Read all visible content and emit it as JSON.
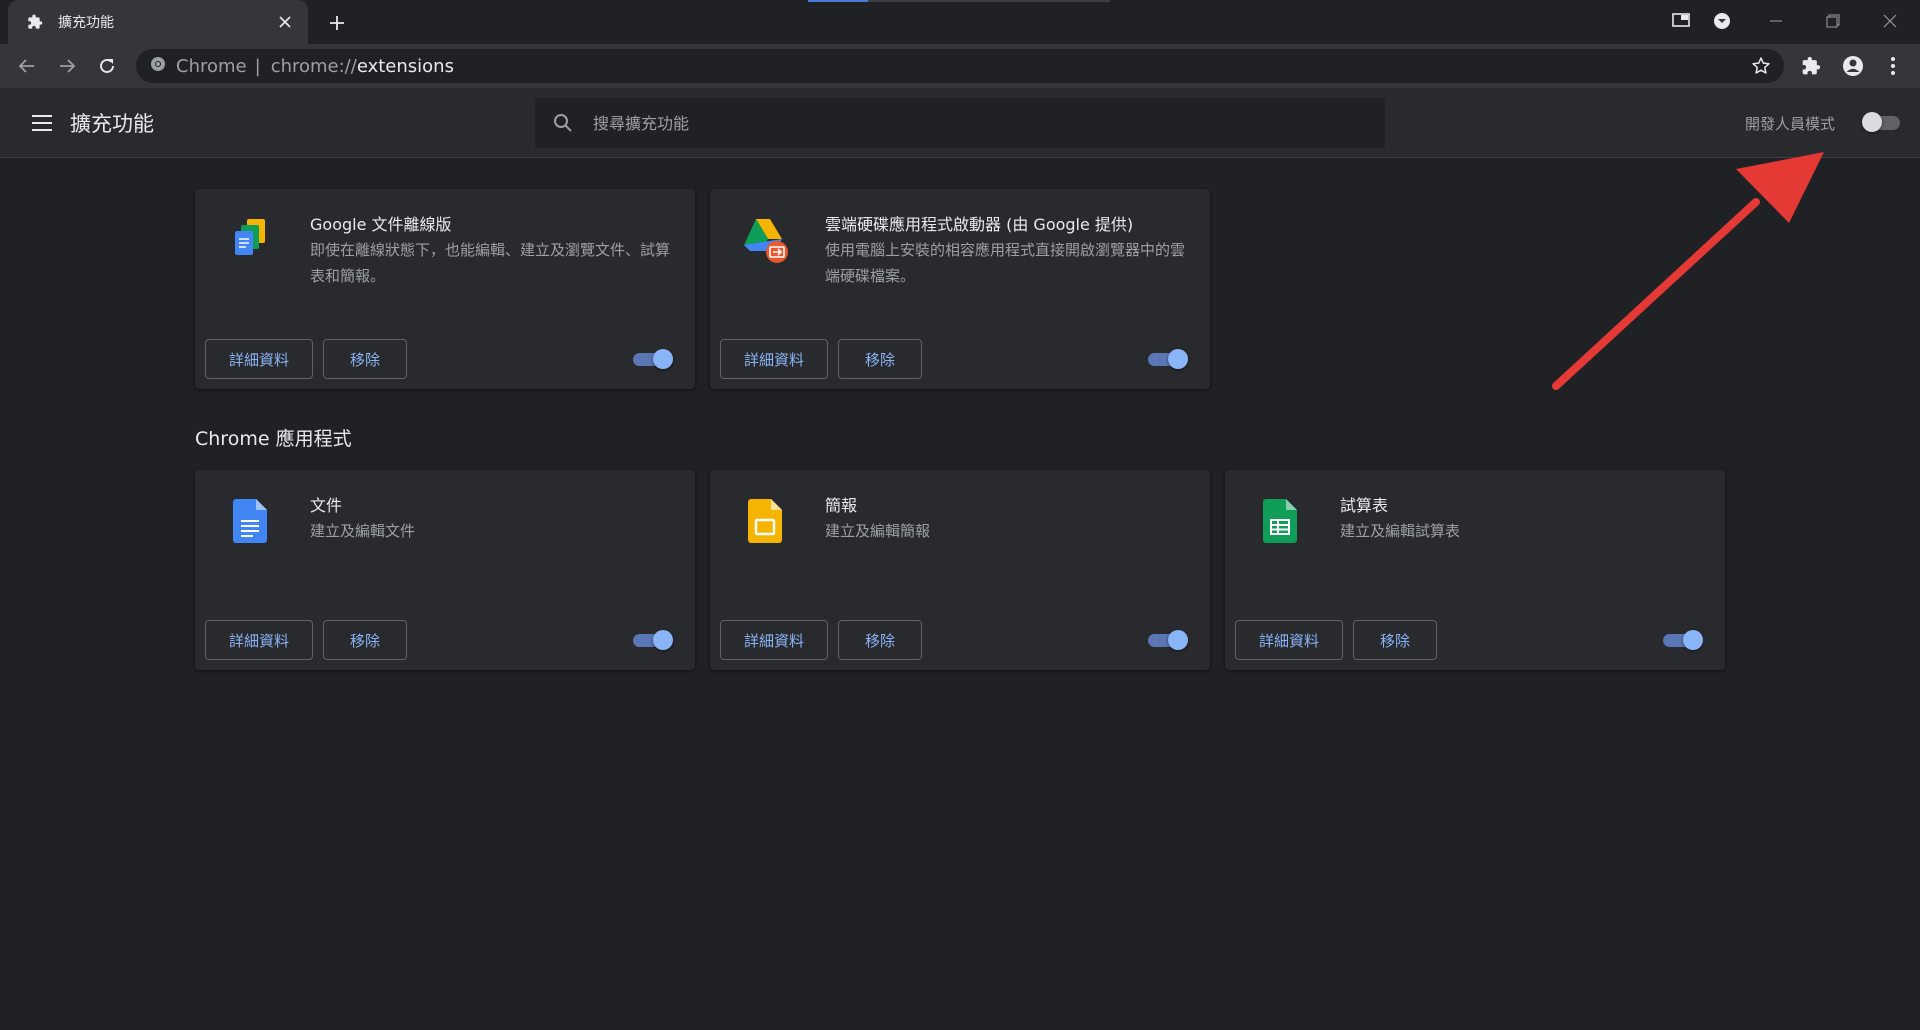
{
  "tab": {
    "title": "擴充功能",
    "favicon": "puzzle-icon"
  },
  "window_controls": [
    "media-icon",
    "profile-dropdown-icon",
    "minimize-icon",
    "restore-icon",
    "close-icon"
  ],
  "omnibox": {
    "site": "Chrome",
    "separator": "|",
    "scheme": "chrome://",
    "host": "extensions"
  },
  "header": {
    "title": "擴充功能",
    "search_placeholder": "搜尋擴充功能",
    "dev_mode_label": "開發人員模式",
    "dev_mode_on": false
  },
  "extensions": [
    {
      "name": "Google 文件離線版",
      "description": "即使在離線狀態下，也能編輯、建立及瀏覽文件、試算表和簡報。",
      "details_label": "詳細資料",
      "remove_label": "移除",
      "enabled": true,
      "icon": "docs-offline-icon"
    },
    {
      "name": "雲端硬碟應用程式啟動器 (由 Google 提供)",
      "description": "使用電腦上安裝的相容應用程式直接開啟瀏覽器中的雲端硬碟檔案。",
      "details_label": "詳細資料",
      "remove_label": "移除",
      "enabled": true,
      "icon": "drive-launcher-icon"
    }
  ],
  "apps_section_title": "Chrome 應用程式",
  "apps": [
    {
      "name": "文件",
      "description": "建立及編輯文件",
      "details_label": "詳細資料",
      "remove_label": "移除",
      "enabled": true,
      "icon": "google-docs-icon",
      "color": "#4285f4"
    },
    {
      "name": "簡報",
      "description": "建立及編輯簡報",
      "details_label": "詳細資料",
      "remove_label": "移除",
      "enabled": true,
      "icon": "google-slides-icon",
      "color": "#f4b400"
    },
    {
      "name": "試算表",
      "description": "建立及編輯試算表",
      "details_label": "詳細資料",
      "remove_label": "移除",
      "enabled": true,
      "icon": "google-sheets-icon",
      "color": "#0f9d58"
    }
  ],
  "colors": {
    "accent": "#8ab4f8",
    "background": "#202124",
    "card": "#292a2d",
    "arrow": "#e53935"
  }
}
